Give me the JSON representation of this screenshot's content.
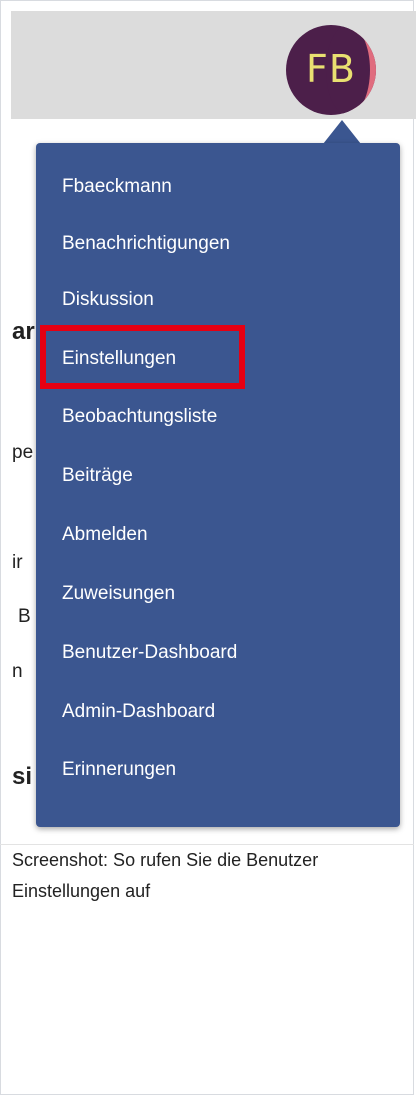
{
  "avatar": {
    "initials": "FB"
  },
  "background_fragments": {
    "frag1": "ar",
    "frag2": "pe",
    "frag3": "ir",
    "frag4": "B",
    "frag5": "n",
    "frag6": "si"
  },
  "menu": {
    "items": [
      {
        "label": "Fbaeckmann"
      },
      {
        "label": "Benachrichtigungen"
      },
      {
        "label": "Diskussion"
      },
      {
        "label": "Einstellungen"
      },
      {
        "label": "Beobachtungsliste"
      },
      {
        "label": "Beiträge"
      },
      {
        "label": "Abmelden"
      },
      {
        "label": "Zuweisungen"
      },
      {
        "label": "Benutzer-Dashboard"
      },
      {
        "label": "Admin-Dashboard"
      },
      {
        "label": "Erinnerungen"
      }
    ],
    "highlighted_item": "Einstellungen"
  },
  "caption": {
    "text": "Screenshot: So rufen Sie die Benutzer Einstellungen auf"
  },
  "colors": {
    "menu_bg": "#3b5690",
    "highlight": "#e60012",
    "topbar_bg": "#dcdcdc",
    "avatar_bg": "#4c1f4a",
    "avatar_text": "#e9e071"
  }
}
